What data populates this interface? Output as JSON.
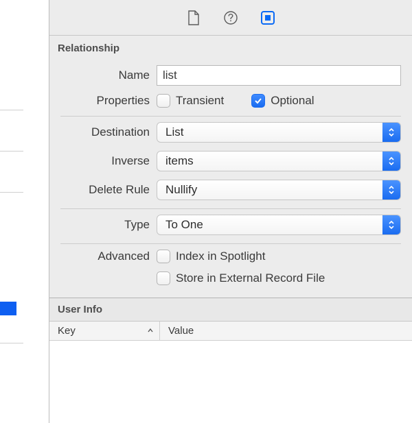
{
  "section": {
    "relationship_title": "Relationship",
    "user_info_title": "User Info"
  },
  "fields": {
    "name_label": "Name",
    "name_value": "list",
    "properties_label": "Properties",
    "transient_label": "Transient",
    "transient_checked": false,
    "optional_label": "Optional",
    "optional_checked": true,
    "destination_label": "Destination",
    "destination_value": "List",
    "inverse_label": "Inverse",
    "inverse_value": "items",
    "delete_rule_label": "Delete Rule",
    "delete_rule_value": "Nullify",
    "type_label": "Type",
    "type_value": "To One",
    "advanced_label": "Advanced",
    "index_spotlight_label": "Index in Spotlight",
    "index_spotlight_checked": false,
    "store_external_label": "Store in External Record File",
    "store_external_checked": false
  },
  "table": {
    "key_header": "Key",
    "value_header": "Value"
  }
}
